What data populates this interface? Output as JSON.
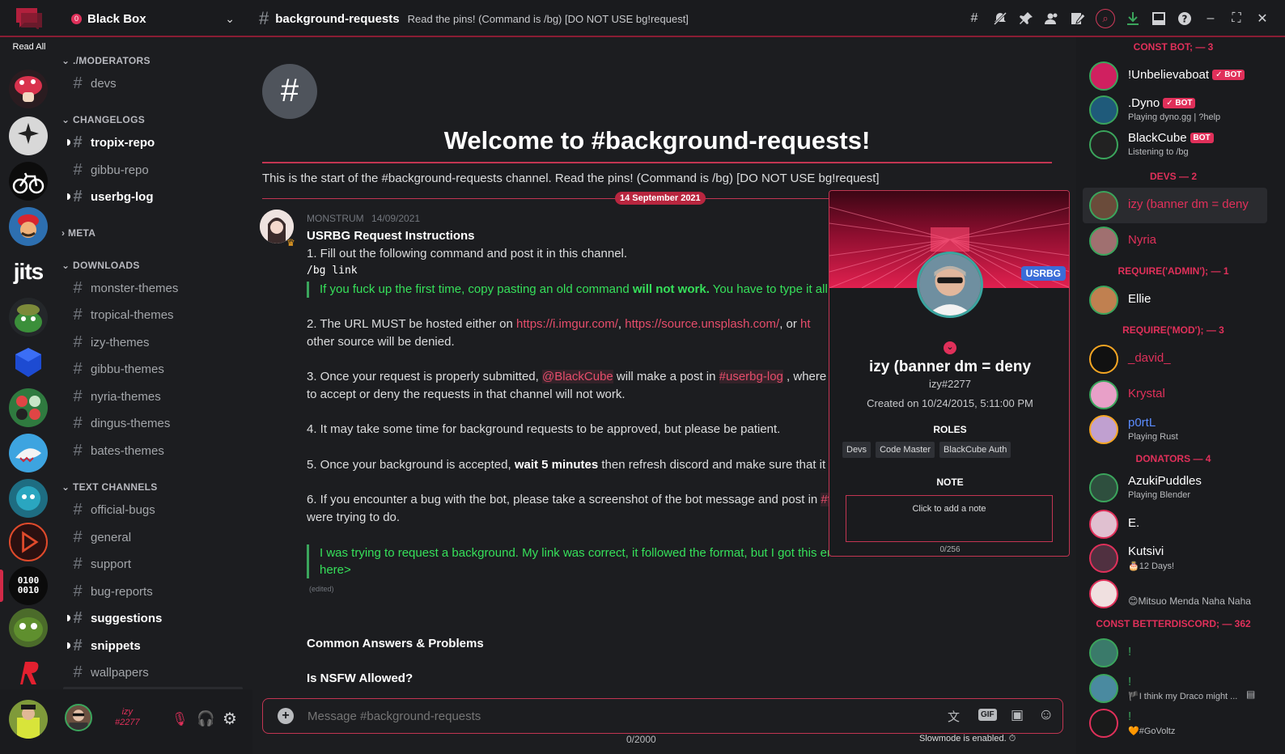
{
  "app": {
    "read_all": "Read All"
  },
  "server": {
    "name": "Black Box",
    "badge": "0"
  },
  "header": {
    "channel": "background-requests",
    "topic": "Read the pins! (Command is /bg) [DO NOT USE bg!request]"
  },
  "servers": {
    "jits_label": "jits",
    "binary_label": "0100\n0010"
  },
  "channels": {
    "categories": [
      "./MODERATORS",
      "CHANGELOGS",
      "META",
      "DOWNLOADS",
      "TEXT CHANNELS"
    ],
    "items": [
      "devs",
      "tropix-repo",
      "gibbu-repo",
      "userbg-log",
      "monster-themes",
      "tropical-themes",
      "izy-themes",
      "gibbu-themes",
      "nyria-themes",
      "dingus-themes",
      "bates-themes",
      "official-bugs",
      "general",
      "support",
      "bug-reports",
      "suggestions",
      "snippets",
      "wallpapers"
    ]
  },
  "user_panel": {
    "name": "izy",
    "tag": "#2277"
  },
  "welcome": {
    "title": "Welcome to #background-requests!",
    "description": "This is the start of the #background-requests channel. Read the pins! (Command is /bg) [DO NOT USE bg!request]"
  },
  "divider_date": "14 September 2021",
  "message": {
    "author": "MONSTRUM",
    "timestamp": "14/09/2021",
    "title": "USRBG Request Instructions",
    "line1": "1. Fill out the following command and post it in this channel.",
    "code": "/bg link",
    "quote1_a": "If you fuck up the first time, copy pasting an old command ",
    "quote1_b": "will not work.",
    "quote1_c": " You have to type it all a",
    "line2_a": "2. The URL MUST be hosted either on ",
    "link1": "https://i.imgur.com/",
    "link2": "https://source.unsplash.com/",
    "line2_b": ", or ",
    "link3": "ht",
    "line2_c": "other source will be denied.",
    "line3_a": "3. Once your request is properly submitted, ",
    "mention_bot": "@BlackCube",
    "line3_b": " will make a post in ",
    "mention_chan": "#userbg-log",
    "line3_c": " , where",
    "line3_d": "to accept or deny the requests in that channel will not work.",
    "line4": "4. It may take some time for background requests to be approved, but please be patient.",
    "line5_a": "5. Once your background is accepted, ",
    "line5_b": "wait 5 minutes",
    "line5_c": " then refresh discord and make sure that it wa",
    "line6_a": "6. If you encounter a bug with the bot, please take a screenshot of the bot message and post in ",
    "line6_mention": "#t",
    "line6_b": "were trying to do.",
    "quote2_a": "I was trying to request a background. My link was correct, it followed the format, but I got this er",
    "quote2_b": "here>",
    "edited": "(edited)",
    "heading1": "Common Answers & Problems",
    "heading2": "Is NSFW Allowed?"
  },
  "composer": {
    "placeholder": "Message #background-requests",
    "counter": "0/2000",
    "slowmode": "Slowmode is enabled."
  },
  "popout": {
    "badge": "USRBG",
    "name": "izy (banner dm = deny",
    "tag": "izy#2277",
    "created": "Created on 10/24/2015, 5:11:00 PM",
    "roles_title": "ROLES",
    "roles": [
      "Devs",
      "Code Master",
      "BlackCube Auth"
    ],
    "note_title": "NOTE",
    "note_placeholder": "Click to add a note",
    "note_count": "0/256"
  },
  "members": {
    "cat_constbot": "CONST BOT; — 3",
    "cat_devs": "DEVS — 2",
    "cat_admin": "REQUIRE('ADMIN'); — 1",
    "cat_mod": "REQUIRE('MOD'); — 3",
    "cat_donators": "DONATORS — 4",
    "cat_bd": "CONST BETTERDISCORD; — 362",
    "bot_label": "BOT",
    "list": [
      {
        "name": "!Unbelievaboat",
        "status": "",
        "color": "#ffffff"
      },
      {
        "name": ".Dyno",
        "status": "Playing dyno.gg | ?help",
        "color": "#ffffff"
      },
      {
        "name": "BlackCube",
        "status": "Listening to /bg",
        "color": "#ffffff"
      },
      {
        "name": "izy (banner dm = deny",
        "status": "",
        "color": "#e0305a"
      },
      {
        "name": "Nyria",
        "status": "",
        "color": "#e0305a"
      },
      {
        "name": "Ellie",
        "status": "",
        "color": "#ffffff"
      },
      {
        "name": "_david_",
        "status": "",
        "color": "#e0305a"
      },
      {
        "name": "Krystal",
        "status": "",
        "color": "#e0305a"
      },
      {
        "name": "p0rtL",
        "status": "Playing Rust",
        "color": "#5b8cff"
      },
      {
        "name": "AzukiPuddles",
        "status": "Playing Blender",
        "color": "#ffffff"
      },
      {
        "name": "E.",
        "status": "",
        "color": "#ffffff"
      },
      {
        "name": "Kutsivi",
        "status": "🎂12 Days!",
        "color": "#ffffff"
      },
      {
        "name": "",
        "status": "😊Mitsuo Menda Naha Naha",
        "color": "#ffffff"
      },
      {
        "name": "!",
        "status": "",
        "color": "#3ba55c"
      },
      {
        "name": "!",
        "status": "🏴I think my Draco might ...",
        "color": "#3ba55c"
      },
      {
        "name": "!",
        "status": "🧡#GoVoltz",
        "color": "#3ba55c"
      }
    ]
  },
  "colors": {
    "accent": "#c23552",
    "green": "#36e05a",
    "bg": "#1c1d20"
  }
}
